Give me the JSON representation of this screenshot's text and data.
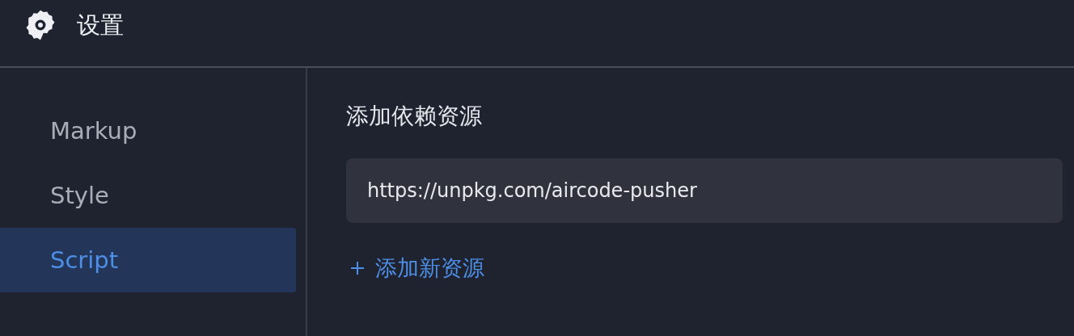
{
  "window": {
    "title": "设置"
  },
  "sidebar": {
    "items": [
      {
        "label": "Markup",
        "selected": false
      },
      {
        "label": "Style",
        "selected": false
      },
      {
        "label": "Script",
        "selected": true
      }
    ]
  },
  "content": {
    "heading": "添加依赖资源",
    "resources": [
      {
        "value": "https://unpkg.com/aircode-pusher"
      }
    ],
    "add_link": "添加新资源"
  }
}
